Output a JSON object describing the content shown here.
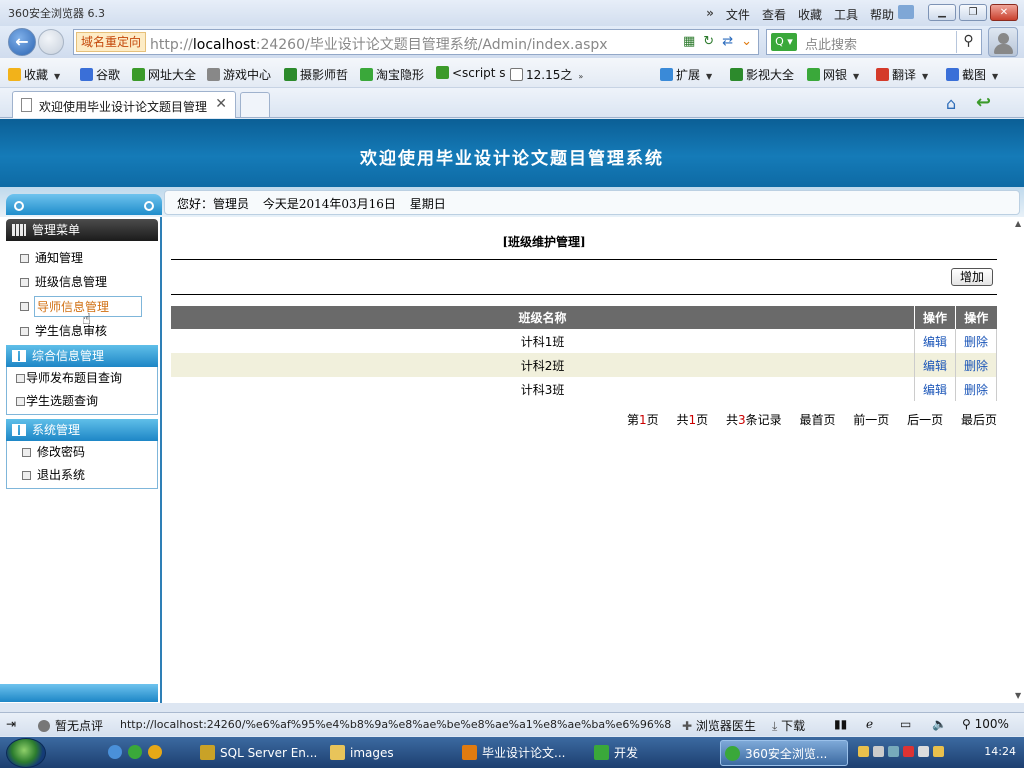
{
  "browser": {
    "app_title": "360安全浏览器 6.3",
    "menus": [
      "文件",
      "查看",
      "收藏",
      "工具",
      "帮助"
    ],
    "redirect_label": "域名重定向",
    "url_prefix": "http://",
    "url_host": "localhost",
    "url_rest": ":24260/毕业设计论文题目管理系统/Admin/index.aspx",
    "search_placeholder": "点此搜索",
    "search_engine": "Q ▾",
    "tab_title": "欢迎使用毕业设计论文题目管理",
    "favorites": [
      {
        "label": "收藏",
        "icon": "star-icon",
        "color": "#f2b21a"
      },
      {
        "label": "谷歌",
        "icon": "google-icon",
        "color": "#3a6fd8"
      },
      {
        "label": "网址大全",
        "icon": "plus-icon",
        "color": "#3b9a2a"
      },
      {
        "label": "游戏中心",
        "icon": "gamepad-icon",
        "color": "#888888"
      },
      {
        "label": "摄影师哲",
        "icon": "douban-icon",
        "color": "#2c8a2c"
      },
      {
        "label": "淘宝隐形",
        "icon": "search-green-icon",
        "color": "#3aa83a"
      },
      {
        "label": "<script s",
        "icon": "plus-icon",
        "color": "#3b9a2a"
      },
      {
        "label": "12.15之",
        "icon": "doc-icon",
        "color": "#ffffff"
      }
    ],
    "right_tools": [
      {
        "label": "扩展",
        "icon": "grid-icon",
        "color": "#3a8ad8"
      },
      {
        "label": "影视大全",
        "icon": "play-icon",
        "color": "#2c8a2c"
      },
      {
        "label": "网银",
        "icon": "money-icon",
        "color": "#3aa83a"
      },
      {
        "label": "翻译",
        "icon": "translate-icon",
        "color": "#d43a2a"
      },
      {
        "label": "截图",
        "icon": "scissors-icon",
        "color": "#3a6fd8"
      }
    ]
  },
  "page": {
    "banner_title": "欢迎使用毕业设计论文题目管理系统",
    "welcome": {
      "greeting": "您好：管理员",
      "date": "今天是2014年03月16日",
      "weekday": "星期日"
    },
    "sidebar": {
      "section1_title": "管理菜单",
      "section1_items": [
        "通知管理",
        "班级信息管理",
        "导师信息管理",
        "学生信息审核"
      ],
      "section2_title": "综合信息管理",
      "section2_items": [
        "导师发布题目查询",
        "学生选题查询"
      ],
      "section3_title": "系统管理",
      "section3_items": [
        "修改密码",
        "退出系统"
      ]
    },
    "main": {
      "title": "[班级维护管理]",
      "add_button": "增加",
      "table": {
        "headers": [
          "班级名称",
          "操作",
          "操作"
        ],
        "rows": [
          {
            "name": "计科1班",
            "edit": "编辑",
            "delete": "删除"
          },
          {
            "name": "计科2班",
            "edit": "编辑",
            "delete": "删除"
          },
          {
            "name": "计科3班",
            "edit": "编辑",
            "delete": "删除"
          }
        ]
      },
      "pager": {
        "page_prefix": "第",
        "page_num": "1",
        "page_suffix": "页",
        "total_prefix": "共",
        "total_pages": "1",
        "total_suffix": "页",
        "records_prefix": "共",
        "records": "3",
        "records_suffix": "条记录",
        "first": "最首页",
        "prev": "前一页",
        "next": "后一页",
        "last": "最后页"
      }
    }
  },
  "statusbar": {
    "rating": "暂无点评",
    "hover_url": "http://localhost:24260/%e6%af%95%e4%b8%9a%e8%ae%be%e8%ae%a1%e8%ae%ba%e6%96%87%e9%a2%98",
    "doctor": "浏览器医生",
    "download": "下载",
    "zoom": "100%"
  },
  "taskbar": {
    "items": [
      {
        "label": "SQL Server En...",
        "icon": "sqlserver-icon",
        "color": "#c9a227"
      },
      {
        "label": "images",
        "icon": "folder-icon",
        "color": "#e8c45a"
      },
      {
        "label": "毕业设计论文...",
        "icon": "visualstudio-icon",
        "color": "#e07b10"
      },
      {
        "label": "开发",
        "icon": "tree-icon",
        "color": "#3aa83a"
      },
      {
        "label": "360安全浏览...",
        "icon": "browser360-icon",
        "color": "#3aa83a"
      }
    ],
    "clock": "14:24"
  }
}
